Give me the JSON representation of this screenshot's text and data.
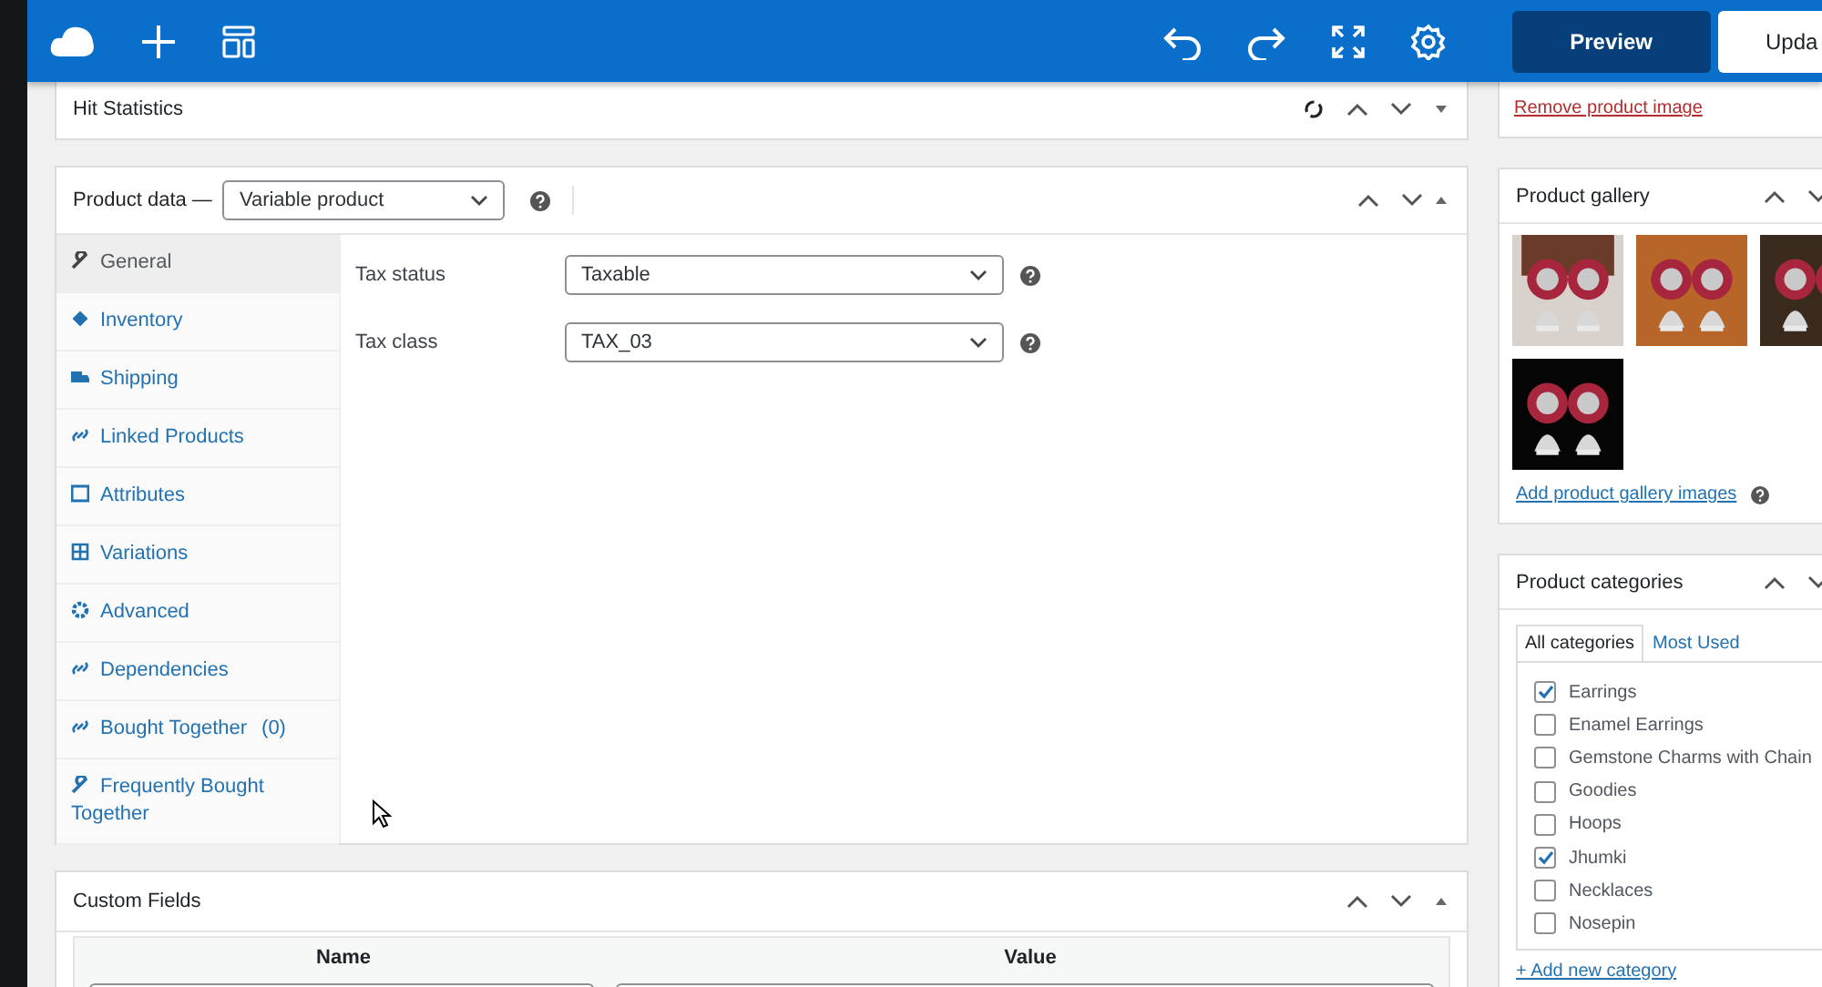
{
  "toolbar": {
    "buttons": [
      {
        "label": "Preview",
        "kind": "primary"
      },
      {
        "label": "Upda",
        "kind": "secondary"
      }
    ]
  },
  "hit_statistics": {
    "title": "Hit Statistics"
  },
  "product_data": {
    "title": "Product data —",
    "type_select": "Variable product",
    "tabs": [
      {
        "label": "General",
        "selected": true
      },
      {
        "label": "Inventory",
        "selected": false
      },
      {
        "label": "Shipping",
        "selected": false
      },
      {
        "label": "Linked Products",
        "selected": false
      },
      {
        "label": "Attributes",
        "selected": false
      },
      {
        "label": "Variations",
        "selected": false
      },
      {
        "label": "Advanced",
        "selected": false
      },
      {
        "label": "Dependencies",
        "selected": false
      },
      {
        "label": "Bought Together",
        "count": "(0)",
        "selected": false
      },
      {
        "label": "Frequently Bought Together",
        "selected": false
      }
    ],
    "fields": [
      {
        "label": "Tax status",
        "value": "Taxable"
      },
      {
        "label": "Tax class",
        "value": "TAX_03"
      }
    ]
  },
  "custom_fields": {
    "title": "Custom Fields",
    "columns": [
      "Name",
      "Value"
    ]
  },
  "product_image": {
    "remove_link": "Remove product image"
  },
  "product_gallery": {
    "title": "Product gallery",
    "add_link": "Add product gallery images"
  },
  "product_categories": {
    "title": "Product categories",
    "tabs": [
      {
        "label": "All categories",
        "selected": true
      },
      {
        "label": "Most Used",
        "selected": false
      }
    ],
    "items": [
      {
        "label": "Earrings",
        "checked": true
      },
      {
        "label": "Enamel Earrings",
        "checked": false
      },
      {
        "label": "Gemstone Charms with Chain",
        "checked": false
      },
      {
        "label": "Goodies",
        "checked": false
      },
      {
        "label": "Hoops",
        "checked": false
      },
      {
        "label": "Jhumki",
        "checked": true
      },
      {
        "label": "Necklaces",
        "checked": false
      },
      {
        "label": "Nosepin",
        "checked": false
      }
    ],
    "add_link": "+ Add new category"
  }
}
